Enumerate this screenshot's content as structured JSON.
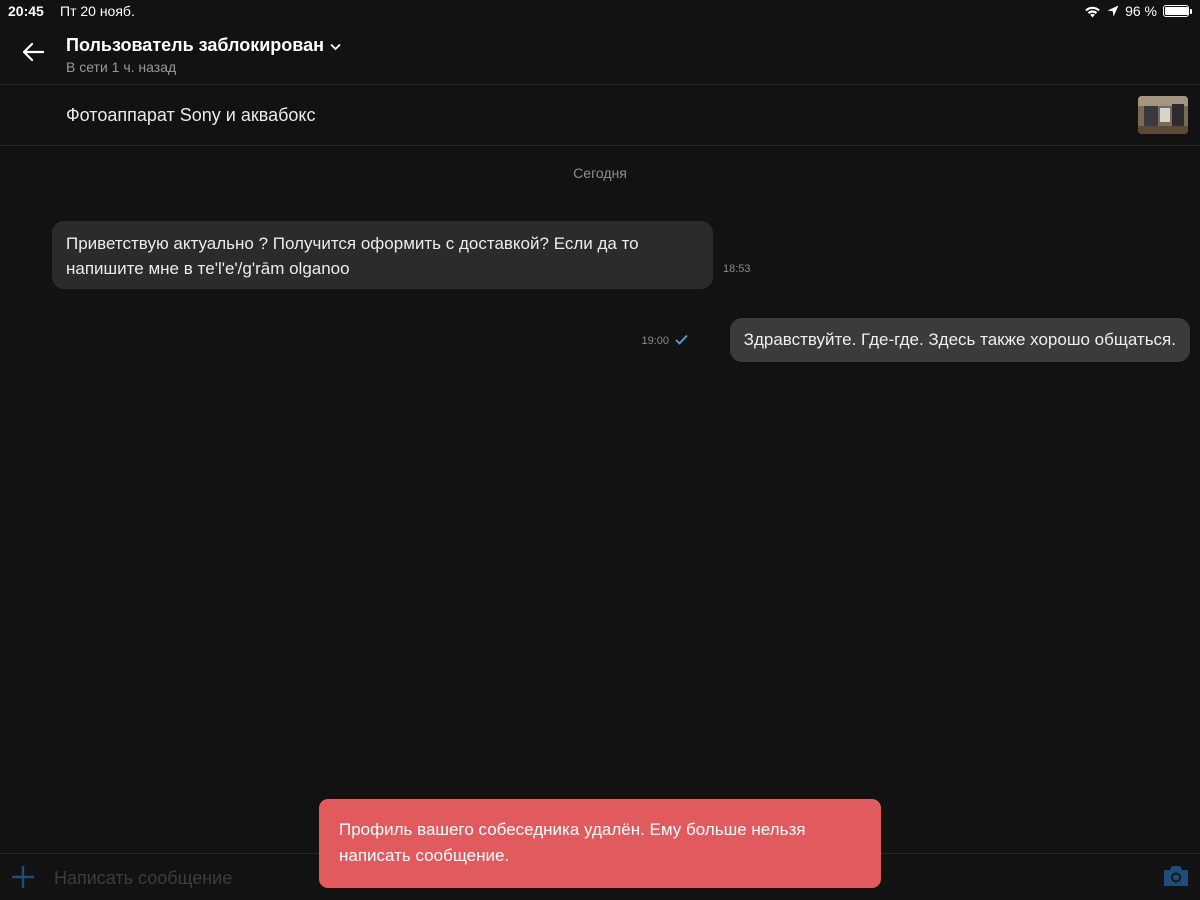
{
  "status_bar": {
    "time": "20:45",
    "date": "Пт 20 нояб.",
    "battery": "96 %",
    "battery_level": 0.96
  },
  "header": {
    "title": "Пользователь заблокирован",
    "subtitle": "В сети 1 ч. назад"
  },
  "item": {
    "title": "Фотоаппарат Sony и аквабокс"
  },
  "chat": {
    "date_separator": "Сегодня",
    "messages": [
      {
        "direction": "incoming",
        "text": "Приветствую   актуально ? Получится  оформить с доставкой? Если да то напишите мне   в тe'l'e'/g'rām olganoo",
        "time": "18:53"
      },
      {
        "direction": "outgoing",
        "text": "Здравствуйте. Где-где. Здесь также хорошо общаться.",
        "time": "19:00",
        "status": "sent-check"
      }
    ]
  },
  "composer": {
    "placeholder": "Написать сообщение"
  },
  "toast": {
    "text": "Профиль вашего собеседника удалён. Ему больше нельзя написать сообщение."
  },
  "colors": {
    "background": "#121212",
    "bubble_incoming": "#2b2b2b",
    "bubble_outgoing": "#3b3b3b",
    "toast": "#e05a5e",
    "accent": "#3d8ed8"
  },
  "icons": [
    "back-arrow-icon",
    "chevron-down-icon",
    "wifi-icon",
    "location-arrow-icon",
    "battery-icon",
    "check-icon",
    "plus-icon",
    "camera-icon"
  ]
}
